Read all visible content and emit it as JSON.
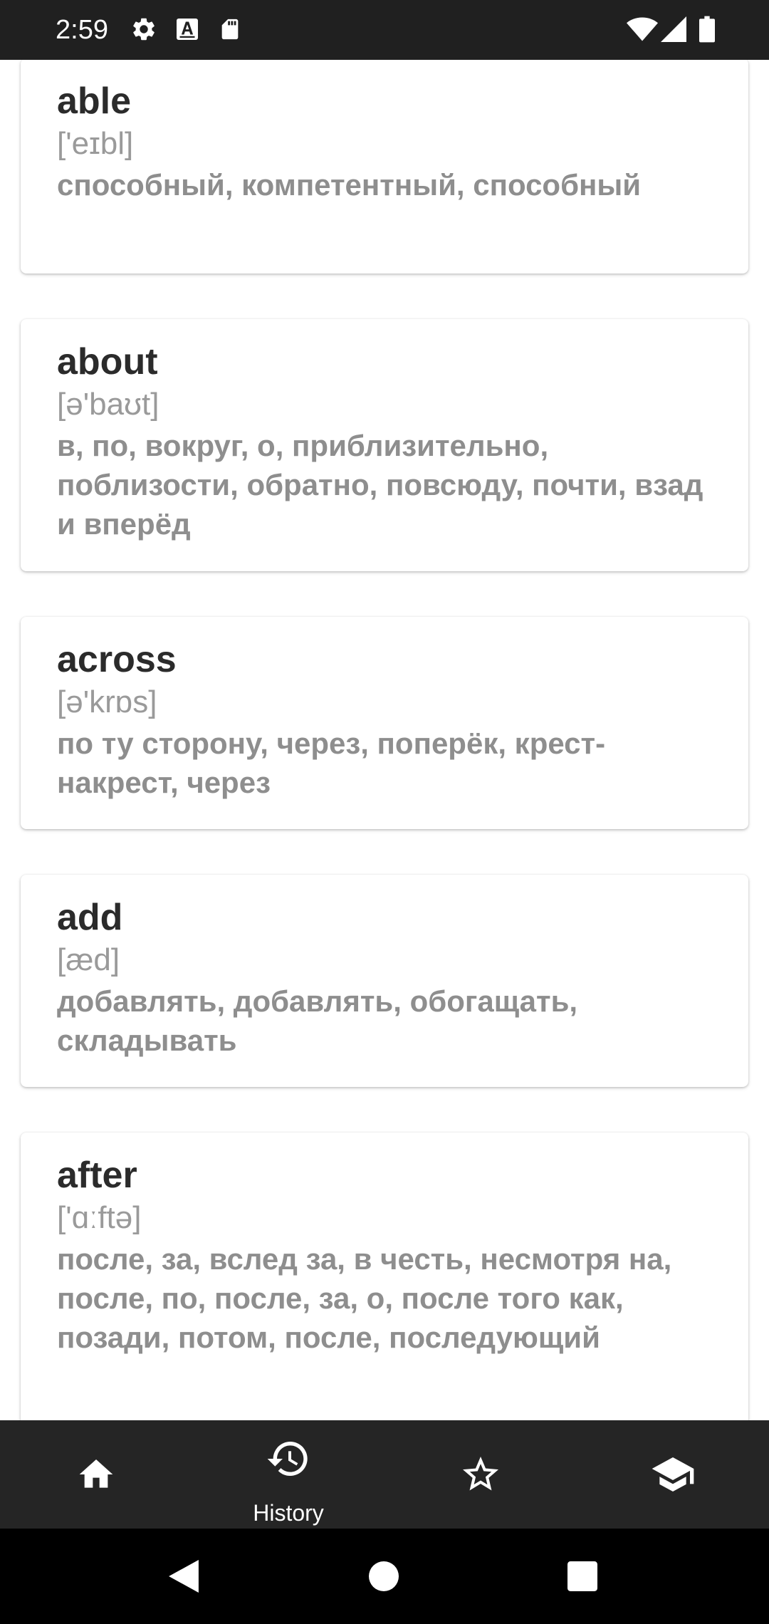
{
  "status_bar": {
    "time": "2:59",
    "icons": [
      "settings-icon",
      "font-a-icon",
      "sd-card-icon",
      "wifi-icon",
      "signal-icon",
      "battery-icon"
    ]
  },
  "words": [
    {
      "word": "able",
      "transcription": "['eɪbl]",
      "translation": "способный, компетентный, способный"
    },
    {
      "word": "about",
      "transcription": "[ə'baʊt]",
      "translation": "в, по, вокруг, о, приблизительно, поблизости, обратно, повсюду, почти, взад и вперёд"
    },
    {
      "word": "across",
      "transcription": "[ə'krɒs]",
      "translation": "по ту сторону, через, поперёк, крест-накрест, через"
    },
    {
      "word": "add",
      "transcription": "[æd]",
      "translation": "добавлять, добавлять, обогащать, складывать"
    },
    {
      "word": "after",
      "transcription": "['ɑːftə]",
      "translation": "после, за, вслед за, в честь, несмотря на, после, по, после, за, о, после того как, позади, потом, после, последующий"
    }
  ],
  "bottom_nav": {
    "home_icon": "home-icon",
    "history_label": "History",
    "history_icon": "history-icon",
    "favorites_icon": "star-icon",
    "learn_icon": "graduation-cap-icon",
    "active_tab": "History"
  },
  "colors": {
    "status_bar": "#202020",
    "nav_bar": "#252525",
    "word_text": "#2b2b2b",
    "secondary_text": "#8e8e8e"
  }
}
